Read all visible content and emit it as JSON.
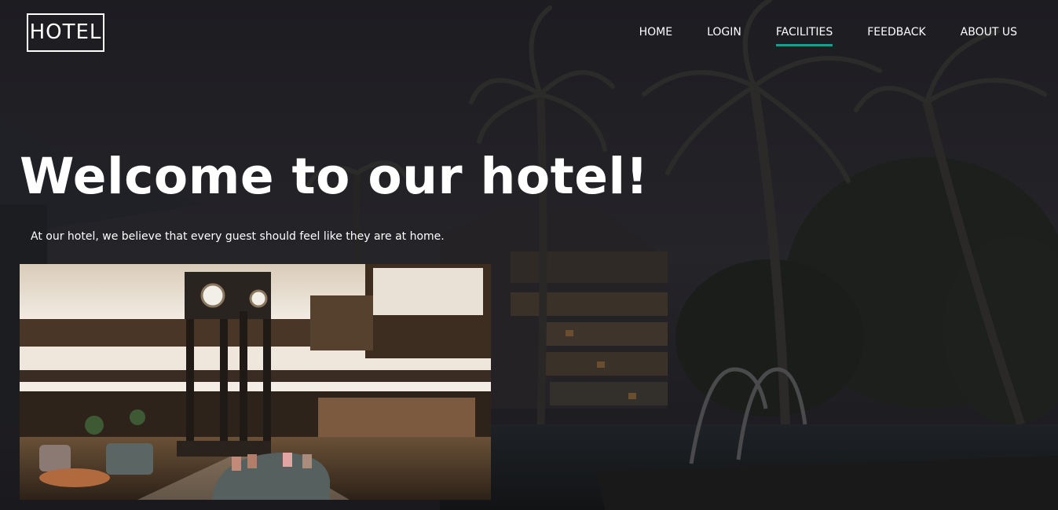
{
  "brand": {
    "logo_text": "HOTEL"
  },
  "nav": {
    "items": [
      {
        "label": "HOME",
        "active": false
      },
      {
        "label": "LOGIN",
        "active": false
      },
      {
        "label": "FACILITIES",
        "active": true
      },
      {
        "label": "FEEDBACK",
        "active": false
      },
      {
        "label": "ABOUT US",
        "active": false
      }
    ],
    "active_underline_color": "#159f8c"
  },
  "hero": {
    "headline": "Welcome to our hotel!",
    "tagline": "At our hotel, we believe that every guest should feel like they are at home."
  },
  "colors": {
    "text": "#ffffff",
    "background": "#1b1a1f"
  }
}
